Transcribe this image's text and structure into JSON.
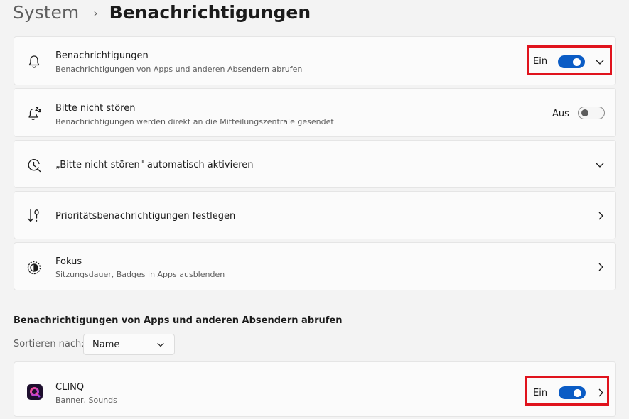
{
  "breadcrumb": {
    "parent": "System",
    "separator": "›",
    "current": "Benachrichtigungen"
  },
  "settings": {
    "notifications": {
      "icon": "bell-icon",
      "title": "Benachrichtigungen",
      "subtitle": "Benachrichtigungen von Apps und anderen Absendern abrufen",
      "state_label": "Ein",
      "enabled": true
    },
    "do_not_disturb": {
      "icon": "bell-snooze-icon",
      "title": "Bitte nicht stören",
      "subtitle": "Benachrichtigungen werden direkt an die Mitteilungszentrale gesendet",
      "state_label": "Aus",
      "enabled": false
    },
    "auto_dnd": {
      "icon": "clock-icon",
      "title": "„Bitte nicht stören\" automatisch aktivieren"
    },
    "priority": {
      "icon": "priority-sort-icon",
      "title": "Prioritätsbenachrichtigungen festlegen"
    },
    "focus": {
      "icon": "focus-icon",
      "title": "Fokus",
      "subtitle": "Sitzungsdauer, Badges in Apps ausblenden"
    }
  },
  "apps_section": {
    "header": "Benachrichtigungen von Apps und anderen Absendern abrufen",
    "sort_label": "Sortieren nach:",
    "sort_value": "Name",
    "apps": [
      {
        "icon": "clinq-app-icon",
        "name": "CLINQ",
        "subtitle": "Banner, Sounds",
        "state_label": "Ein",
        "enabled": true
      }
    ]
  },
  "colors": {
    "accent": "#0b5cc5",
    "highlight": "#e0131d",
    "background": "#f3f3f3",
    "card": "#fbfbfb"
  }
}
